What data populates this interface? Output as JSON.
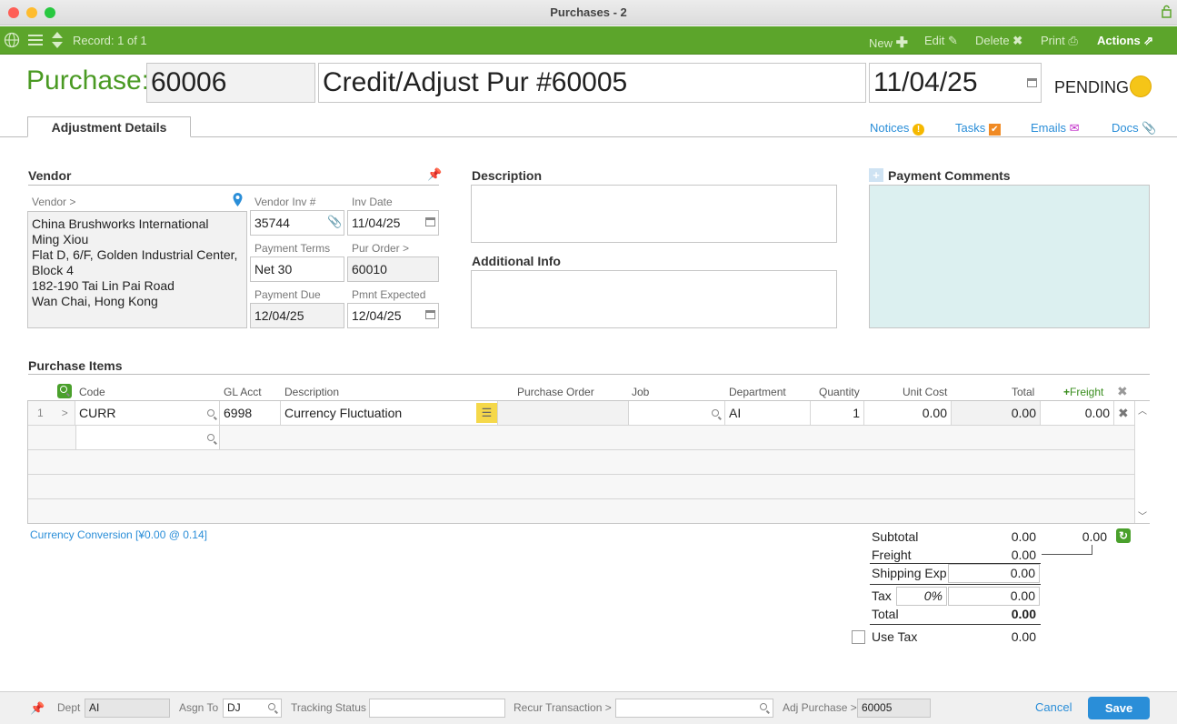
{
  "window": {
    "title": "Purchases - 2"
  },
  "toolbar": {
    "record": "Record: 1 of 1",
    "new": "New",
    "edit": "Edit",
    "delete": "Delete",
    "print": "Print",
    "actions": "Actions"
  },
  "header": {
    "label": "Purchase:",
    "number": "60006",
    "title": "Credit/Adjust Pur #60005",
    "date": "11/04/25",
    "status": "PENDING",
    "status_color": "#f5c518"
  },
  "tabs": {
    "active": "Adjustment Details",
    "notices": "Notices",
    "tasks": "Tasks",
    "emails": "Emails",
    "docs": "Docs"
  },
  "vendor": {
    "section": "Vendor",
    "label": "Vendor >",
    "address": [
      "China Brushworks International",
      "Ming Xiou",
      "Flat D, 6/F, Golden Industrial Center,",
      "Block 4",
      "182-190 Tai Lin Pai Road",
      "Wan Chai, Hong Kong"
    ],
    "inv_label": "Vendor Inv #",
    "inv": "35744",
    "inv_date_label": "Inv Date",
    "inv_date": "11/04/25",
    "terms_label": "Payment Terms",
    "terms": "Net 30",
    "po_label": "Pur Order >",
    "po": "60010",
    "due_label": "Payment Due",
    "due": "12/04/25",
    "expected_label": "Pmnt Expected",
    "expected": "12/04/25"
  },
  "description": {
    "section": "Description",
    "value": ""
  },
  "additional": {
    "section": "Additional Info",
    "value": ""
  },
  "payment_comments": {
    "section": "Payment Comments",
    "value": ""
  },
  "items": {
    "section": "Purchase Items",
    "headers": {
      "code": "Code",
      "gl": "GL Acct",
      "desc": "Description",
      "po": "Purchase Order",
      "job": "Job",
      "dept": "Department",
      "qty": "Quantity",
      "unit": "Unit Cost",
      "total": "Total",
      "freight": "Freight"
    },
    "rows": [
      {
        "num": "1",
        "code": "CURR",
        "gl": "6998",
        "desc": "Currency Fluctuation",
        "po": "",
        "job": "",
        "dept": "AI",
        "qty": "1",
        "unit": "0.00",
        "total": "0.00",
        "freight": "0.00"
      }
    ]
  },
  "currency": "Currency Conversion [¥0.00 @ 0.14]",
  "totals": {
    "subtotal_label": "Subtotal",
    "subtotal": "0.00",
    "subtotal2": "0.00",
    "freight_label": "Freight",
    "freight": "0.00",
    "shipping_label": "Shipping Exp",
    "shipping": "0.00",
    "tax_label": "Tax",
    "tax_rate": "0%",
    "tax": "0.00",
    "total_label": "Total",
    "total": "0.00",
    "use_tax_label": "Use Tax",
    "use_tax": "0.00"
  },
  "footer": {
    "dept_label": "Dept",
    "dept": "AI",
    "assign_label": "Asgn To",
    "assign": "DJ",
    "tracking_label": "Tracking Status",
    "tracking": "",
    "recur_label": "Recur Transaction >",
    "recur": "",
    "adj_label": "Adj Purchase >",
    "adj": "60005",
    "cancel": "Cancel",
    "save": "Save"
  }
}
